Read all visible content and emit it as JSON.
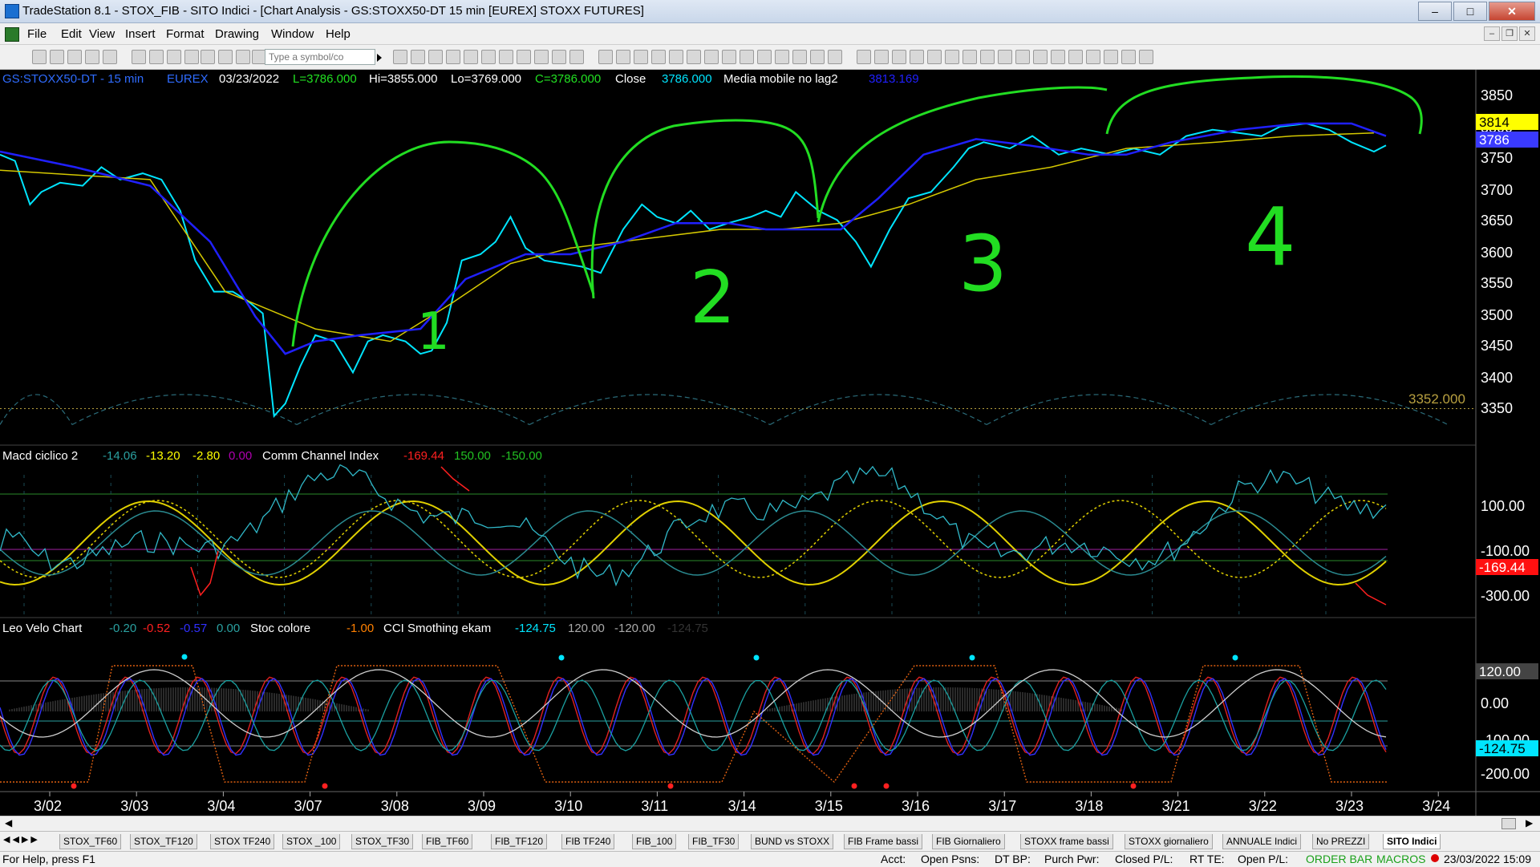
{
  "window": {
    "title": "TradeStation 8.1 - STOX_FIB - SITO Indici - [Chart Analysis - GS:STOXX50-DT  15 min  [EUREX] STOXX FUTURES]"
  },
  "menu": [
    "File",
    "Edit",
    "View",
    "Insert",
    "Format",
    "Drawing",
    "Window",
    "Help"
  ],
  "toolbar": {
    "symbol_placeholder": "Type a symbol/co"
  },
  "price_pane": {
    "symbol": "GS:STOXX50-DT - 15 min",
    "exchange": "EUREX",
    "date": "03/23/2022",
    "last": "L=3786.000",
    "high": "Hi=3855.000",
    "low": "Lo=3769.000",
    "close_eq": "C=3786.000",
    "close_label": "Close",
    "close_value": "3786.000",
    "study_name": "Media mobile no lag2",
    "study_value": "3813.169",
    "axis_labels": [
      "3850",
      "3800",
      "3750",
      "3700",
      "3650",
      "3600",
      "3550",
      "3500",
      "3450",
      "3400",
      "3350"
    ],
    "marker_yellow": "3814",
    "marker_blue": "3786",
    "line_label": "3352.000"
  },
  "macd_pane": {
    "name": "Macd ciclico 2",
    "values": [
      "-14.06",
      "-13.20",
      "-2.80",
      "0.00"
    ],
    "cci_name": "Comm Channel Index",
    "cci_values": [
      "-169.44",
      "150.00",
      "-150.00"
    ],
    "axis_labels": [
      "100.00",
      "-100.00",
      "-300.00"
    ],
    "marker_red": "-169.44"
  },
  "velo_pane": {
    "name": "Leo Velo Chart",
    "values": [
      "-0.20",
      "-0.52",
      "-0.57",
      "0.00"
    ],
    "stoc_name": "Stoc colore",
    "stoc_value": "-1.00",
    "cci_name": "CCI Smothing ekam",
    "cci_values": [
      "-124.75",
      "120.00",
      "-120.00",
      "-124.75"
    ],
    "axis_labels": [
      "120.00",
      "0.00",
      "-100.00",
      "-200.00"
    ],
    "marker_cyan": "-124.75"
  },
  "annotations": [
    "1",
    "2",
    "3",
    "4"
  ],
  "x_axis": [
    "3/02",
    "3/03",
    "3/04",
    "3/07",
    "3/08",
    "3/09",
    "3/10",
    "3/11",
    "3/14",
    "3/15",
    "3/16",
    "3/17",
    "3/18",
    "3/21",
    "3/22",
    "3/23",
    "3/24"
  ],
  "tabs": [
    "STOX_TF60",
    "STOX_TF120",
    "STOX TF240",
    "STOX _100",
    "STOX_TF30",
    "FIB_TF60",
    "FIB_TF120",
    "FIB TF240",
    "FIB_100",
    "FIB_TF30",
    "BUND vs STOXX",
    "FIB Frame bassi",
    "FIB Giornaliero",
    "STOXX frame bassi",
    "STOXX giornaliero",
    "ANNUALE Indici",
    "No PREZZI",
    "SITO Indici"
  ],
  "active_tab": "SITO Indici",
  "status": {
    "help": "For Help, press F1",
    "acct": "Acct:",
    "open_psns": "Open Psns:",
    "dt_bp": "DT BP:",
    "purch_pwr": "Purch Pwr:",
    "closed_pl": "Closed P/L:",
    "rt_te": "RT TE:",
    "open_pl": "Open P/L:",
    "order_bar": "ORDER BAR",
    "macros": "MACROS",
    "datetime": "23/03/2022 15:09"
  },
  "colors": {
    "price_line": "#00e5ff",
    "ma_blue": "#2020ff",
    "ma_yellow": "#d4c800",
    "annotation_green": "#22dd22",
    "cci_red": "#ff2020"
  }
}
